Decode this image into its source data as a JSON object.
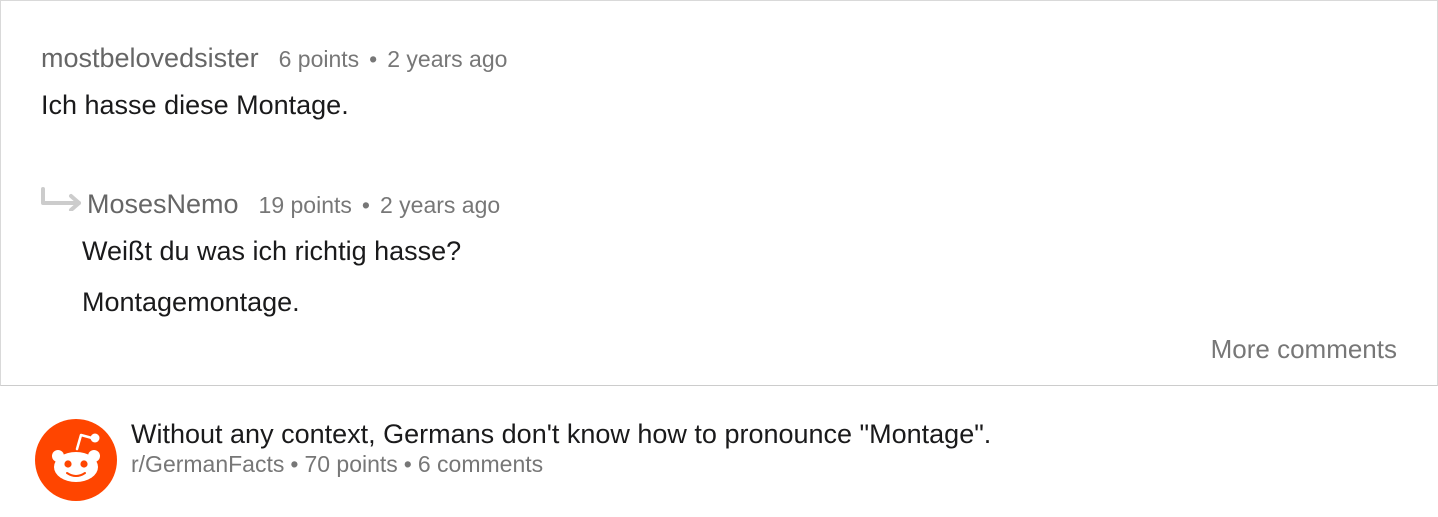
{
  "comments": [
    {
      "author": "mostbelovedsister",
      "points": "6 points",
      "age": "2 years ago",
      "body": [
        "Ich hasse diese Montage."
      ]
    },
    {
      "author": "MosesNemo",
      "points": "19 points",
      "age": "2 years ago",
      "body": [
        "Weißt du was ich richtig hasse?",
        "Montagemontage."
      ]
    }
  ],
  "separator": "•",
  "more_comments_label": "More comments",
  "post": {
    "title": "Without any context, Germans don't know how to pronounce \"Montage\".",
    "subreddit": "r/GermanFacts",
    "points": "70 points",
    "comments": "6 comments"
  },
  "icons": {
    "reply": "reply-arrow-icon",
    "logo": "reddit-logo-icon"
  },
  "colors": {
    "logo_bg": "#ff4500",
    "muted_text": "#777777",
    "author_text": "#666666",
    "reply_arrow": "#cccccc"
  }
}
